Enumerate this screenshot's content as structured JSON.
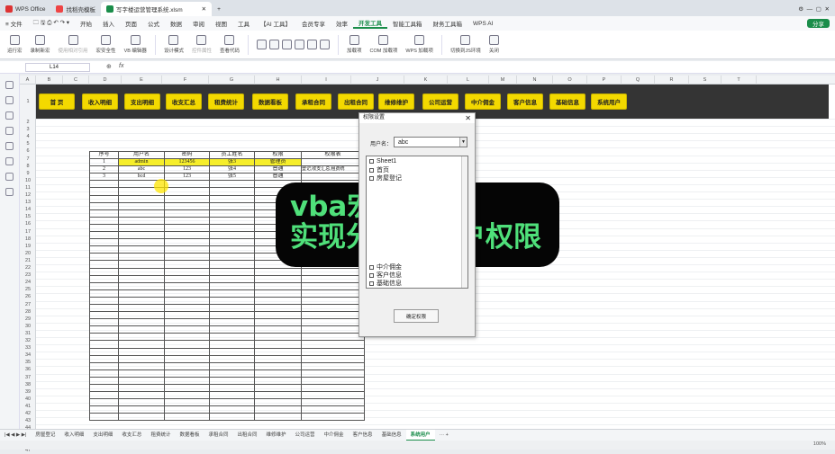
{
  "titlebar": {
    "tabs": [
      "WPS Office",
      "找稻壳模板",
      "写字楼运营管理系统.xlsm"
    ],
    "new_tab": "+",
    "share": "分享"
  },
  "menubar": {
    "file": "≡ 文件",
    "items": [
      "开始",
      "插入",
      "页面",
      "公式",
      "数据",
      "审阅",
      "视图",
      "工具",
      "【AI 工具】",
      "会员专享",
      "效率",
      "开发工具",
      "智能工具箱",
      "财务工具箱",
      "WPS AI"
    ],
    "active": "开发工具"
  },
  "ribbon": {
    "buttons": [
      "运行宏",
      "录制新宏",
      "使用相对引用",
      "宏安全性",
      "VB 编辑器",
      "设计模式",
      "控件属性",
      "查看代码",
      "加载项",
      "COM 加载项",
      "WPS 加载项",
      "切换到JS环境",
      "关闭"
    ]
  },
  "formula": {
    "cell": "L14",
    "fx": "fx"
  },
  "columns": [
    "A",
    "B",
    "C",
    "D",
    "E",
    "F",
    "G",
    "H",
    "I",
    "J",
    "K",
    "L",
    "M",
    "N",
    "O",
    "P",
    "Q",
    "R",
    "S",
    "T"
  ],
  "nav": [
    "首 页",
    "收入明细",
    "支出明细",
    "收支汇总",
    "租费统计",
    "数据看板",
    "承租合同",
    "出租合同",
    "维修维护",
    "公司运营",
    "中介佣金",
    "客户信息",
    "基础信息",
    "系统用户"
  ],
  "user_table": {
    "headers": [
      "序号",
      "用户名",
      "密码",
      "员工姓名",
      "权限",
      "权限表"
    ],
    "rows": [
      [
        "1",
        "admin",
        "123456",
        "张3",
        "管理员",
        ""
      ],
      [
        "2",
        "abc",
        "123",
        "张4",
        "普通",
        "登记,收支汇总,租费统"
      ],
      [
        "3",
        "bcd",
        "123",
        "张5",
        "普通",
        ""
      ]
    ]
  },
  "dialog": {
    "title": "权限设置",
    "user_label": "用户名：",
    "user_value": "abc",
    "list_items": [
      "Sheet1",
      "首页",
      "房屋登记",
      "中介佣金",
      "客户信息",
      "基础信息"
    ],
    "confirm": "确定权限"
  },
  "overlay": {
    "line1": "vba宏窗体",
    "line2": "实现分配多用户权限"
  },
  "sheet_tabs": [
    "房屋登记",
    "收入明细",
    "支出明细",
    "收支汇总",
    "租费统计",
    "数据看板",
    "承租合同",
    "出租合同",
    "维修维护",
    "公司运营",
    "中介佣金",
    "客户信息",
    "基础信息",
    "系统用户"
  ],
  "active_sheet": "系统用户",
  "status": {
    "zoom": "100%"
  }
}
